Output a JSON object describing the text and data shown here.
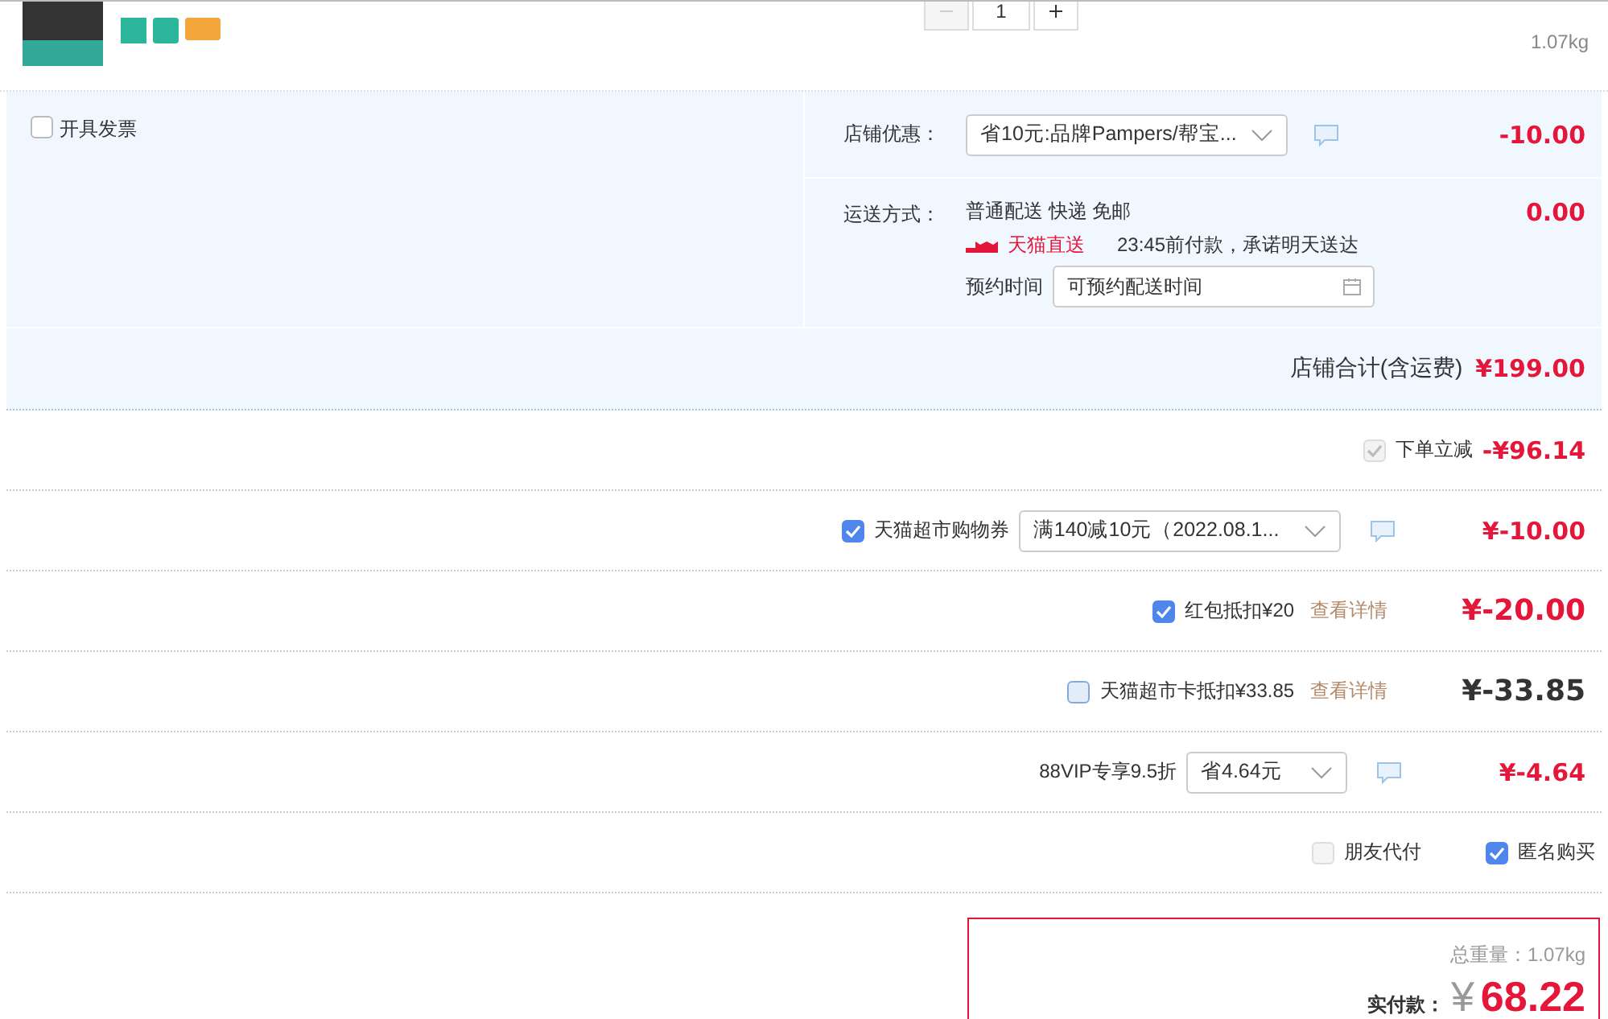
{
  "product": {
    "quantity": "1",
    "weight": "1.07kg"
  },
  "shop": {
    "invoice": {
      "label": "开具发票",
      "checked": false
    },
    "discount": {
      "label": "店铺优惠：",
      "option": "省10元:品牌Pampers/帮宝...",
      "amount": "-10.00"
    },
    "shipping": {
      "label": "运送方式：",
      "method": "普通配送 快递 免邮",
      "brand": "天猫直送",
      "promise": "23:45前付款，承诺明天送达",
      "schedule_label": "预约时间",
      "schedule_placeholder": "可预约配送时间",
      "amount": "0.00"
    },
    "total_label": "店铺合计(含运费)",
    "total": "¥199.00"
  },
  "discounts": [
    {
      "kind": "check",
      "label": "下单立减",
      "checked": true,
      "disabled": true,
      "amount": "-¥96.14"
    },
    {
      "kind": "coupon",
      "label": "天猫超市购物券",
      "checked": true,
      "disabled": false,
      "option": "满140减10元（2022.08.1...",
      "amount": "¥-10.00"
    },
    {
      "kind": "deduct",
      "label": "红包抵扣¥20",
      "checked": true,
      "disabled": false,
      "link": "查看详情",
      "amount": "¥-20.00"
    },
    {
      "kind": "deduct",
      "label": "天猫超市卡抵扣¥33.85",
      "checked": false,
      "disabled": false,
      "link": "查看详情",
      "amount": "¥-33.85"
    },
    {
      "kind": "vip",
      "label": "88VIP专享9.5折",
      "option": "省4.64元",
      "amount": "¥-4.64"
    }
  ],
  "options": [
    {
      "label": "朋友代付",
      "checked": false
    },
    {
      "label": "匿名购买",
      "checked": true
    }
  ],
  "summary": {
    "weight": "总重量：1.07kg",
    "pay_label": "实付款：",
    "currency": "¥",
    "total": "68.22"
  }
}
